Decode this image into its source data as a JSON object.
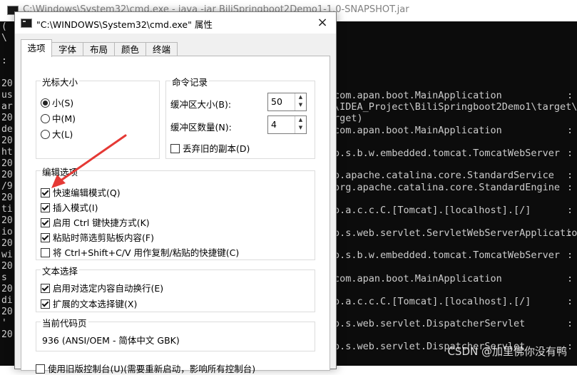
{
  "console": {
    "title": "C:\\Windows\\System32\\cmd.exe - java  -jar BiliSpringboot2Demo1-1.0-SNAPSHOT.jar",
    "left_fragments": [
      "(",
      "\\",
      "",
      " :",
      "",
      "20",
      "us",
      "ar",
      "20",
      "de",
      "20",
      "ht",
      "20",
      "20",
      "/9",
      "20",
      "ti",
      "20",
      "io",
      "20",
      "wi",
      "20",
      "s",
      "20",
      "di",
      "20",
      "'",
      "20"
    ],
    "log_lines": [
      "com.apan.boot.MainApplication",
      "\\IDEA_Project\\BiliSpringboot2Demo1\\target\\Bi",
      "rget)",
      "com.apan.boot.MainApplication",
      "o.s.b.w.embedded.tomcat.TomcatWebServer",
      "o.apache.catalina.core.StandardService",
      "org.apache.catalina.core.StandardEngine",
      "o.a.c.c.C.[Tomcat].[localhost].[/]",
      "o.s.web.servlet.ServletWebServerApplicationContext",
      "o.s.b.w.embedded.tomcat.TomcatWebServer",
      "com.apan.boot.MainApplication",
      "o.a.c.c.C.[Tomcat].[localhost].[/]",
      "o.s.web.servlet.DispatcherServlet",
      "o.s.web.servlet.DispatcherServlet"
    ],
    "colon": ":",
    "watermark": "CSDN @加里佛你没有鸭"
  },
  "dialog": {
    "title": "\"C:\\WINDOWS\\System32\\cmd.exe\" 属性",
    "close_glyph": "×",
    "tabs": [
      "选项",
      "字体",
      "布局",
      "颜色",
      "终端"
    ],
    "cursor_group": {
      "title": "光标大小",
      "options": [
        {
          "label": "小(S)",
          "checked": true
        },
        {
          "label": "中(M)",
          "checked": false
        },
        {
          "label": "大(L)",
          "checked": false
        }
      ]
    },
    "history_group": {
      "title": "命令记录",
      "buffer_size_label": "缓冲区大小(B):",
      "buffer_size_value": "50",
      "buffer_count_label": "缓冲区数量(N):",
      "buffer_count_value": "4",
      "discard_label": "丢弃旧的副本(D)"
    },
    "edit_group": {
      "title": "编辑选项",
      "options": [
        {
          "label": "快速编辑模式(Q)",
          "checked": true
        },
        {
          "label": "插入模式(I)",
          "checked": true
        },
        {
          "label": "启用 Ctrl 键快捷方式(K)",
          "checked": true
        },
        {
          "label": "粘贴时筛选剪贴板内容(F)",
          "checked": true
        },
        {
          "label": "将 Ctrl+Shift+C/V 用作复制/粘贴的快捷键(C)",
          "checked": false
        }
      ]
    },
    "text_select_group": {
      "title": "文本选择",
      "options": [
        {
          "label": "启用对选定内容自动换行(E)",
          "checked": true
        },
        {
          "label": "扩展的文本选择键(X)",
          "checked": true
        }
      ]
    },
    "codepage_group": {
      "title": "当前代码页",
      "value": "936   (ANSI/OEM - 简体中文 GBK)"
    },
    "bottom_option": "使用旧版控制台(U)(需要重新启动，影响所有控制台)"
  },
  "colors": {
    "annotation_arrow": "#e53935",
    "console_bg": "#0c0c0c"
  }
}
